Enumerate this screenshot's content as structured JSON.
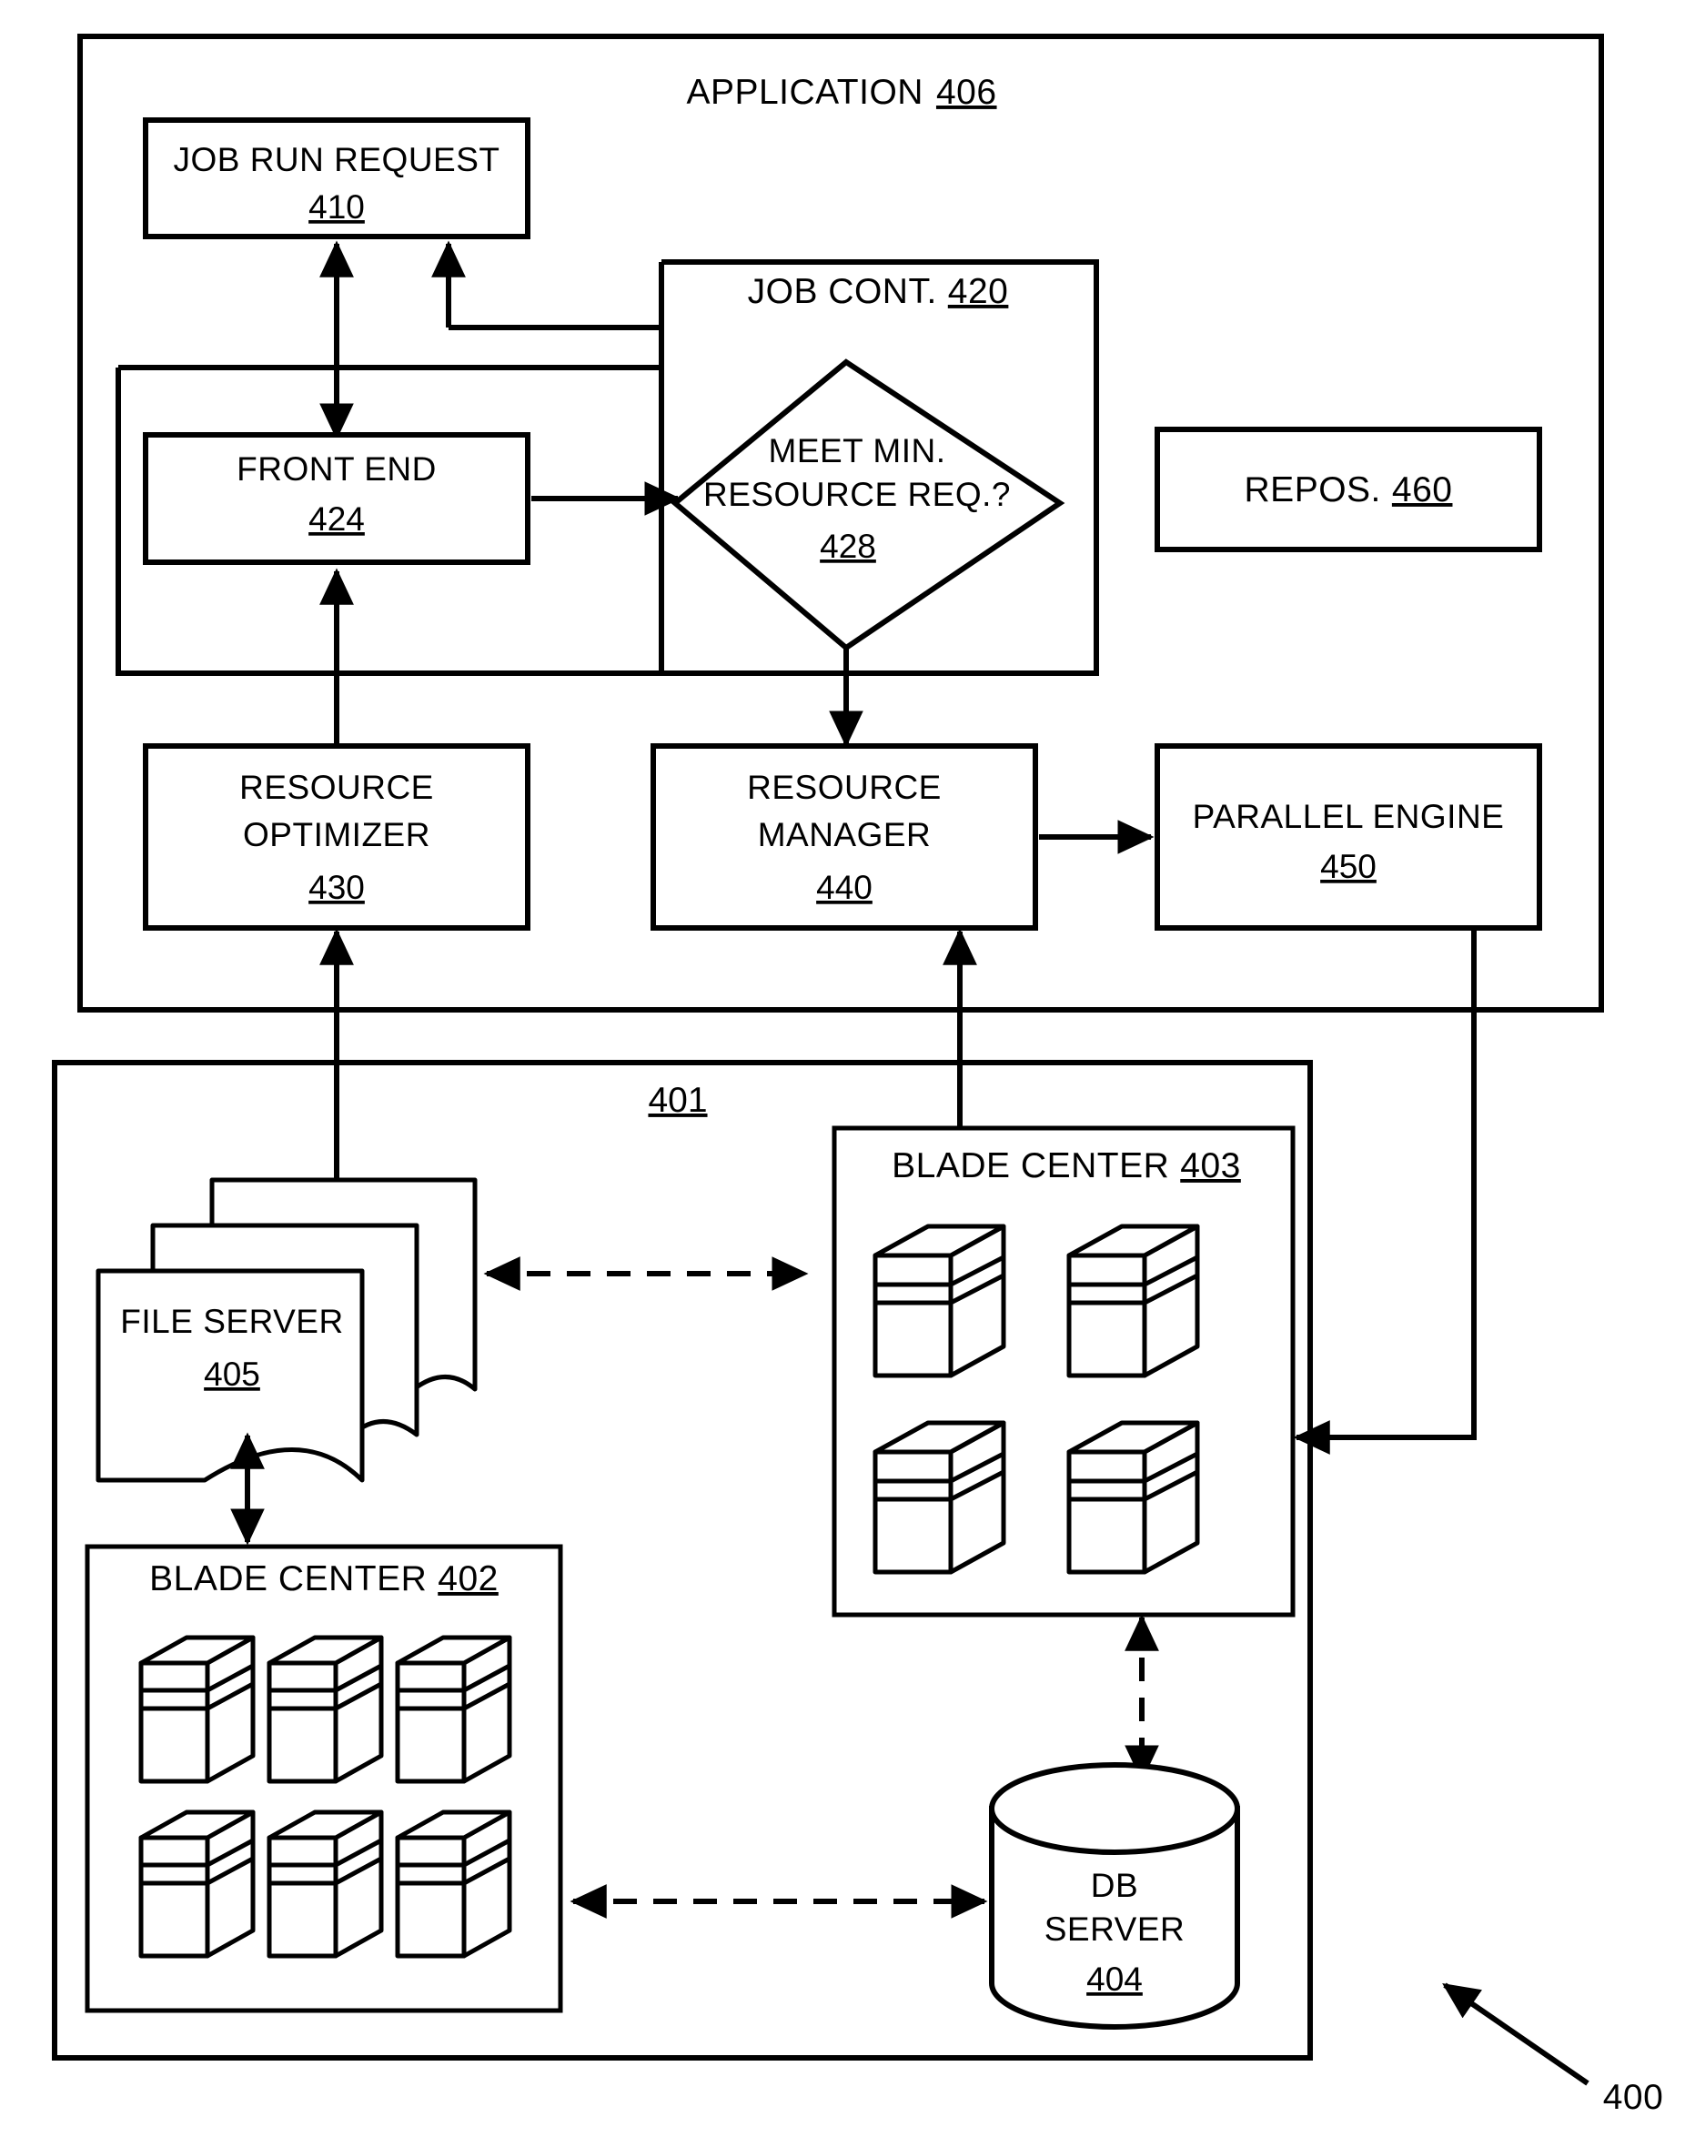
{
  "figure": {
    "figure_number": "400",
    "application_container": {
      "label": "APPLICATION",
      "ref": "406"
    },
    "network_container": {
      "ref": "401"
    },
    "boxes": {
      "job_run_request": {
        "line1": "JOB RUN REQUEST",
        "ref": "410"
      },
      "job_cont": {
        "line1": "JOB CONT.",
        "ref": "420"
      },
      "front_end": {
        "line1": "FRONT END",
        "ref": "424"
      },
      "decision": {
        "line1": "MEET MIN.",
        "line2": "RESOURCE REQ.?",
        "ref": "428"
      },
      "repository": {
        "line1": "REPOS.",
        "ref": "460"
      },
      "resource_optimizer": {
        "line1": "RESOURCE",
        "line2": "OPTIMIZER",
        "ref": "430"
      },
      "resource_manager": {
        "line1": "RESOURCE",
        "line2": "MANAGER",
        "ref": "440"
      },
      "parallel_engine": {
        "line1": "PARALLEL ENGINE",
        "ref": "450"
      },
      "file_server": {
        "line1": "FILE SERVER",
        "ref": "405"
      },
      "blade_center_403": {
        "line1": "BLADE CENTER",
        "ref": "403",
        "server_count": 4
      },
      "blade_center_402": {
        "line1": "BLADE CENTER",
        "ref": "402",
        "server_count": 6
      },
      "db_server": {
        "line1": "DB",
        "line2": "SERVER",
        "ref": "404"
      }
    },
    "colors": {
      "ink": "#000000",
      "paper": "#ffffff"
    }
  }
}
